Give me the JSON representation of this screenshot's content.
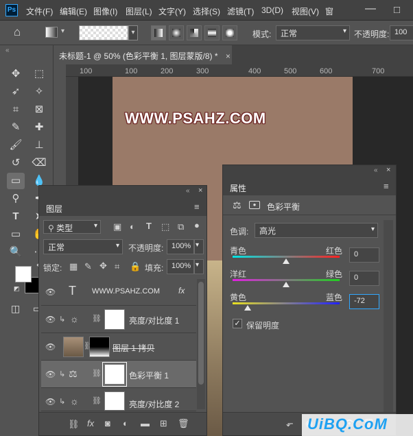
{
  "app": {
    "logo": "Ps"
  },
  "menu": [
    "文件(F)",
    "编辑(E)",
    "图像(I)",
    "图层(L)",
    "文字(Y)",
    "选择(S)",
    "滤镜(T)",
    "3D(D)",
    "视图(V)",
    "窗"
  ],
  "options": {
    "mode_label": "模式:",
    "mode_value": "正常",
    "opacity_label": "不透明度:",
    "opacity_value": "100"
  },
  "document": {
    "tab_title": "未标题-1 @ 50% (色彩平衡 1, 图层蒙版/8) *",
    "close": "×"
  },
  "ruler": {
    "ticks": [
      "100",
      "100",
      "200",
      "300",
      "400",
      "500",
      "600",
      "700"
    ]
  },
  "canvas": {
    "text": "WWW.PSAHZ.COM"
  },
  "layers_panel": {
    "tab": "图层",
    "filter_label": "类型",
    "blend_mode": "正常",
    "opacity_label": "不透明度:",
    "opacity_value": "100%",
    "lock_label": "锁定:",
    "fill_label": "填充:",
    "fill_value": "100%",
    "layers": [
      {
        "name": "WWW.PSAHZ.COM",
        "fx": "fx"
      },
      {
        "name": "亮度/对比度 1"
      },
      {
        "name": "图层 1 拷贝"
      },
      {
        "name": "色彩平衡 1"
      },
      {
        "name": "亮度/对比度 2"
      }
    ]
  },
  "properties_panel": {
    "tab": "属性",
    "title": "色彩平衡",
    "tone_label": "色调:",
    "tone_value": "高光",
    "sliders": [
      {
        "left": "青色",
        "right": "红色",
        "value": "0",
        "position": 0.5
      },
      {
        "left": "洋红",
        "right": "绿色",
        "value": "0",
        "position": 0.5
      },
      {
        "left": "黄色",
        "right": "蓝色",
        "value": "-72",
        "position": 0.14
      }
    ],
    "preserve_label": "保留明度",
    "preserve_checked": true
  },
  "watermark": "UiBQ.CoM",
  "colors": {
    "accent": "#31a8ff",
    "panel": "#535353",
    "dark": "#424242"
  }
}
